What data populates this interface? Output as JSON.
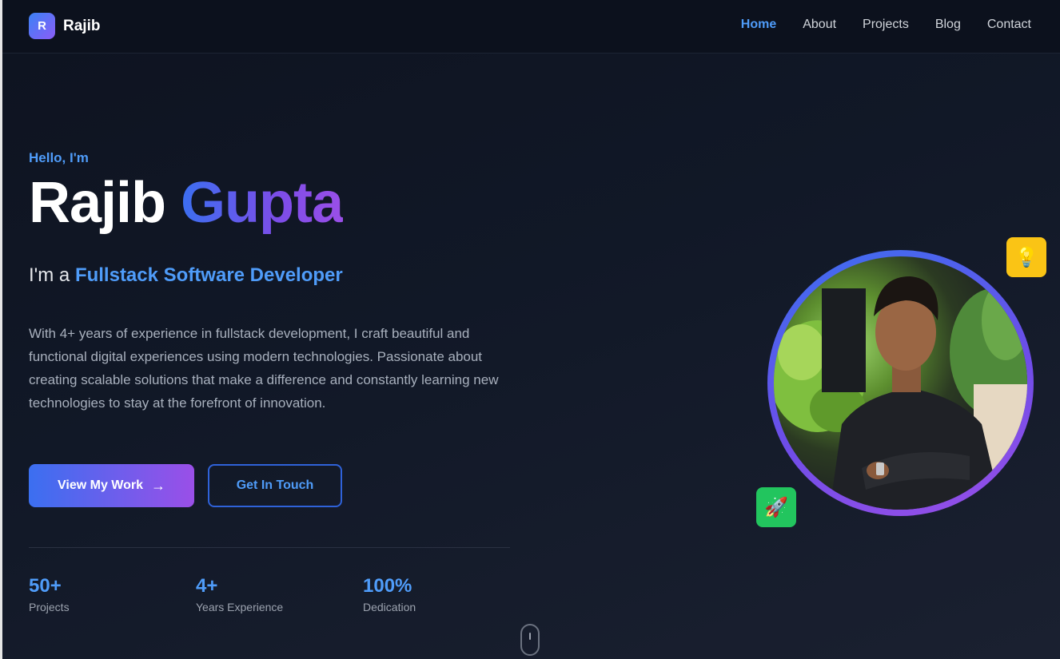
{
  "brand": {
    "initial": "R",
    "name": "Rajib"
  },
  "nav": {
    "items": [
      {
        "label": "Home",
        "active": true
      },
      {
        "label": "About"
      },
      {
        "label": "Projects"
      },
      {
        "label": "Blog"
      },
      {
        "label": "Contact"
      }
    ]
  },
  "hero": {
    "greeting": "Hello, I'm",
    "first_name": "Rajib",
    "last_name": "Gupta",
    "role_prefix": "I'm a",
    "role_title": "Fullstack Software Developer",
    "description": "With 4+ years of experience in fullstack development, I craft beautiful and functional digital experiences using modern technologies. Passionate about creating scalable solutions that make a difference and constantly learning new technologies to stay at the forefront of innovation.",
    "primary_button": "View My Work",
    "primary_button_arrow": "→",
    "secondary_button": "Get In Touch"
  },
  "stats": [
    {
      "value": "50+",
      "label": "Projects"
    },
    {
      "value": "4+",
      "label": "Years Experience"
    },
    {
      "value": "100%",
      "label": "Dedication"
    }
  ],
  "badges": {
    "top_icon": "lightbulb-icon",
    "top_glyph": "💡",
    "bottom_icon": "rocket-icon",
    "bottom_glyph": "🚀"
  },
  "colors": {
    "accent_blue": "#4f9cf9",
    "gradient_start": "#3b6ff0",
    "gradient_end": "#9a4fe8",
    "bulb_badge": "#fac415",
    "rocket_badge": "#22c55e"
  }
}
